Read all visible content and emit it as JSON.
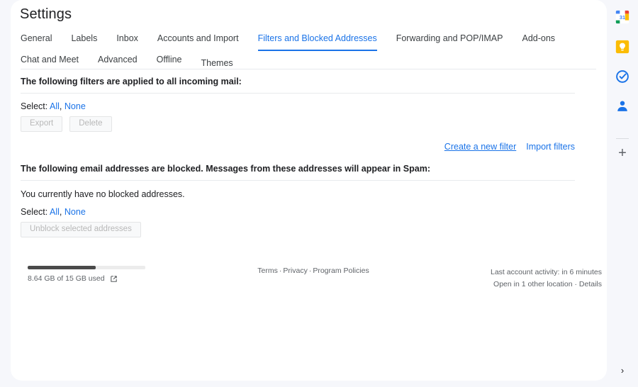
{
  "window": {
    "title": "Settings",
    "background_color": "#f6f7fb",
    "card_color": "#ffffff",
    "accent_color": "#1a73e8"
  },
  "tabs": {
    "row1": [
      {
        "label": "General",
        "active": false
      },
      {
        "label": "Labels",
        "active": false
      },
      {
        "label": "Inbox",
        "active": false
      },
      {
        "label": "Accounts and Import",
        "active": false
      },
      {
        "label": "Filters and Blocked Addresses",
        "active": true
      },
      {
        "label": "Forwarding and POP/IMAP",
        "active": false
      },
      {
        "label": "Add-ons",
        "active": false
      },
      {
        "label": "Chat and Meet",
        "active": false
      },
      {
        "label": "Advanced",
        "active": false
      },
      {
        "label": "Offline",
        "active": false
      }
    ],
    "row2": [
      {
        "label": "Themes",
        "active": false
      }
    ]
  },
  "filters_section": {
    "heading": "The following filters are applied to all incoming mail:",
    "select_label": "Select:",
    "select_all": "All",
    "select_comma": ",",
    "select_none": "None",
    "export_button": "Export",
    "delete_button": "Delete",
    "create_filter_link": "Create a new filter",
    "import_filters_link": "Import filters"
  },
  "blocked_section": {
    "heading": "The following email addresses are blocked. Messages from these addresses will appear in Spam:",
    "empty_message": "You currently have no blocked addresses.",
    "select_label": "Select:",
    "select_all": "All",
    "select_comma": ",",
    "select_none": "None",
    "unblock_button": "Unblock selected addresses"
  },
  "footer": {
    "storage_used_percent": 57.6,
    "storage_text": "8.64 GB of 15 GB used",
    "storage_icon": "external-link-icon",
    "terms": "Terms",
    "sep1": "·",
    "privacy": "Privacy",
    "sep2": "·",
    "program_policies": "Program Policies",
    "last_activity": "Last account activity: in 6 minutes",
    "open_location": "Open in 1 other location",
    "open_location_sep": "·",
    "details": "Details"
  },
  "sidepanel": {
    "items": [
      {
        "name": "calendar-icon",
        "label": "31"
      },
      {
        "name": "keep-icon",
        "label": ""
      },
      {
        "name": "tasks-icon",
        "label": ""
      },
      {
        "name": "contacts-icon",
        "label": ""
      }
    ],
    "add_label": "+",
    "expand_label": "›"
  }
}
